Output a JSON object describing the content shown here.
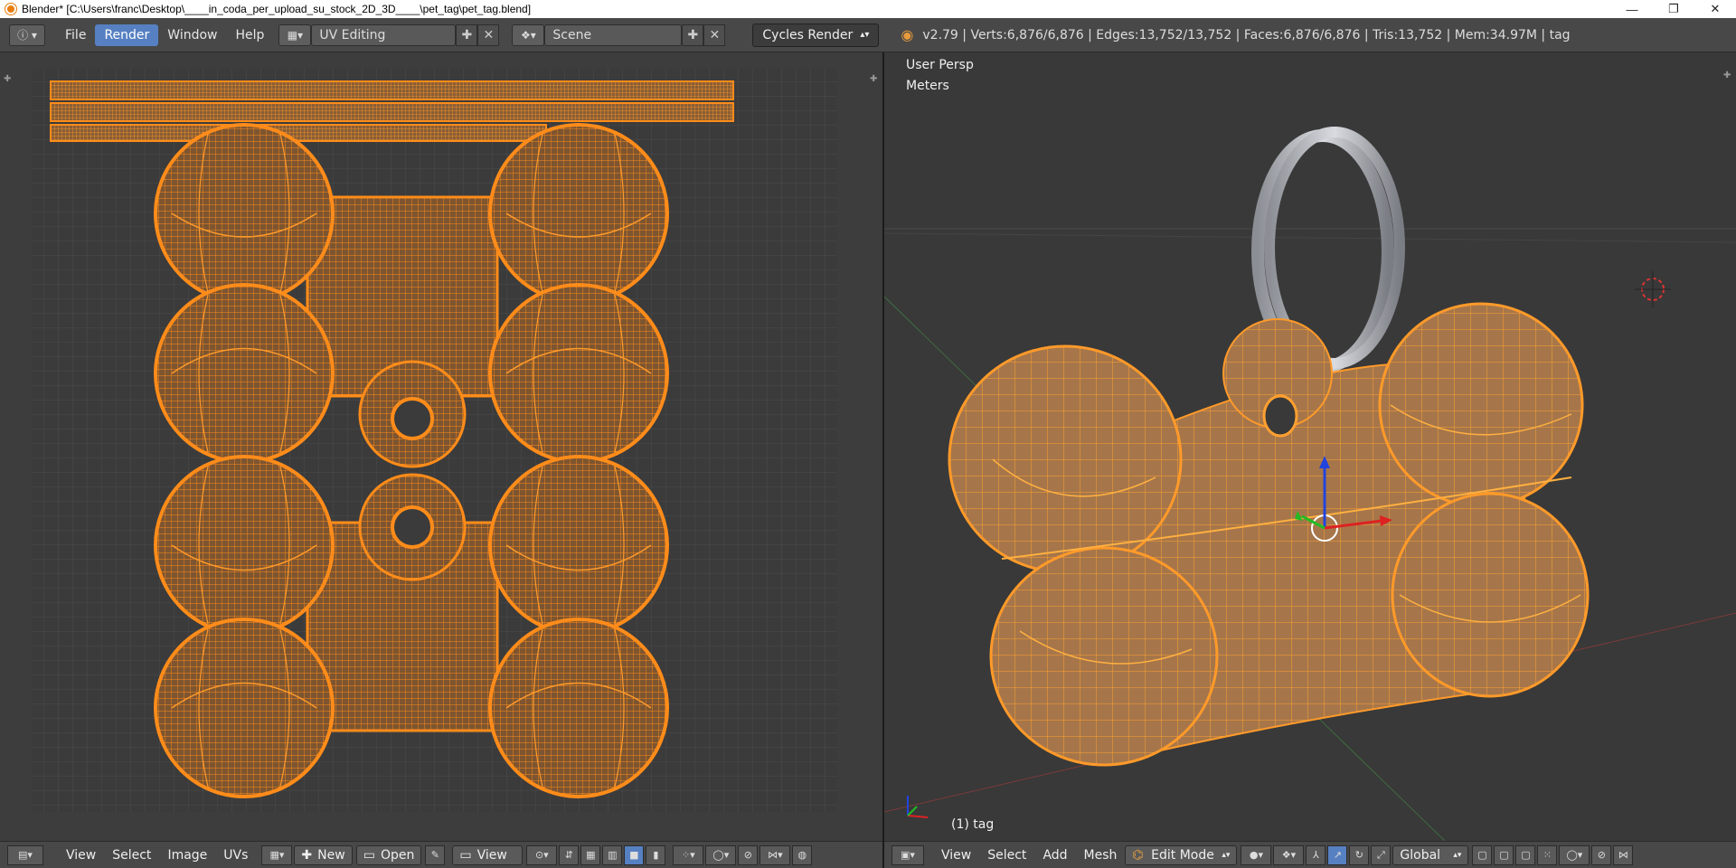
{
  "window": {
    "title": "Blender* [C:\\Users\\franc\\Desktop\\____in_coda_per_upload_su_stock_2D_3D____\\pet_tag\\pet_tag.blend]",
    "minimize": "—",
    "maximize": "❐",
    "close": "✕"
  },
  "menu": {
    "items": [
      "File",
      "Render",
      "Window",
      "Help"
    ],
    "active": "Render"
  },
  "screen_layout": {
    "value": "UV Editing"
  },
  "scene": {
    "value": "Scene"
  },
  "engine": {
    "value": "Cycles Render"
  },
  "stats": "v2.79 | Verts:6,876/6,876 | Edges:13,752/13,752 | Faces:6,876/6,876 | Tris:13,752 | Mem:34.97M | tag",
  "viewport": {
    "view_name": "User Persp",
    "units": "Meters",
    "object_label": "(1) tag"
  },
  "uv_header": {
    "items": [
      "View",
      "Select",
      "Image",
      "UVs"
    ],
    "new_label": "New",
    "open_label": "Open",
    "view_label": "View"
  },
  "view3d_header": {
    "items": [
      "View",
      "Select",
      "Add",
      "Mesh"
    ],
    "mode": "Edit Mode",
    "orientation": "Global"
  },
  "colors": {
    "uv_bg": "#3d3d3d",
    "uv_grid": "#4a4a4a",
    "wire": "#ff8c1a",
    "face": "#8a5e35",
    "accent": "#5680c2"
  },
  "icons": [
    "blender-icon",
    "info-icon",
    "screen-icon",
    "scene-icon",
    "plus-icon",
    "close-icon",
    "render-icon",
    "3d-cursor-icon",
    "manipulator-icon"
  ]
}
